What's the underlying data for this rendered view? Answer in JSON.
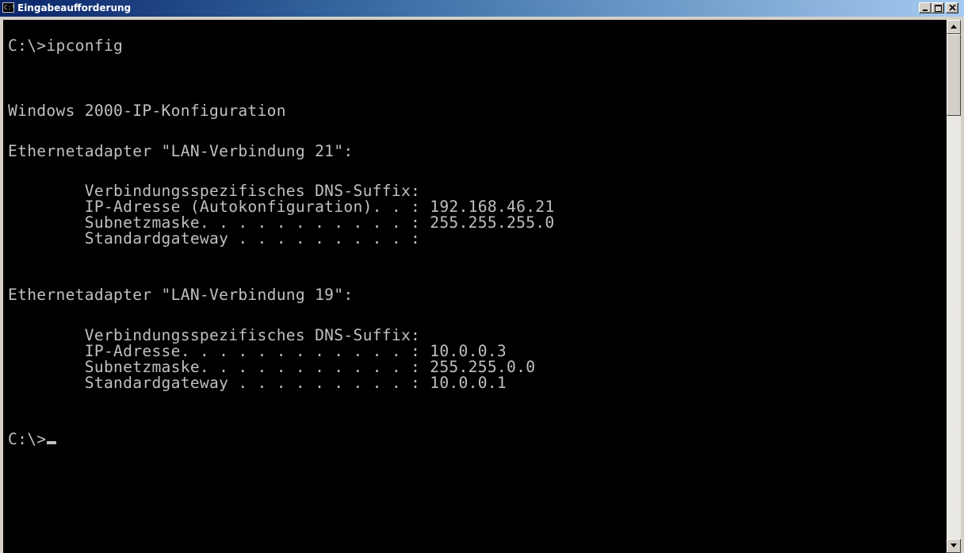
{
  "window": {
    "title": "Eingabeaufforderung",
    "icon": "cmd-icon",
    "icon_label": "C:\\"
  },
  "titlebar_buttons": {
    "minimize": "minimize-icon",
    "maximize": "maximize-icon",
    "close": "close-icon"
  },
  "console": {
    "lines": [
      "C:\\>ipconfig",
      "Windows 2000-IP-Konfiguration",
      "Ethernetadapter \"LAN-Verbindung 21\":",
      "        Verbindungsspezifisches DNS-Suffix:",
      "        IP-Adresse (Autokonfiguration). . : 192.168.46.21",
      "        Subnetzmaske. . . . . . . . . . . : 255.255.255.0",
      "        Standardgateway . . . . . . . . . :",
      "Ethernetadapter \"LAN-Verbindung 19\":",
      "        Verbindungsspezifisches DNS-Suffix:",
      "        IP-Adresse. . . . . . . . . . . . : 10.0.0.3",
      "        Subnetzmaske. . . . . . . . . . . : 255.255.0.0",
      "        Standardgateway . . . . . . . . . : 10.0.0.1",
      "C:\\>"
    ]
  },
  "colors": {
    "console_bg": "#000000",
    "console_fg": "#c0c0c0",
    "titlebar_start": "#0a246a",
    "titlebar_end": "#a6caf0"
  }
}
